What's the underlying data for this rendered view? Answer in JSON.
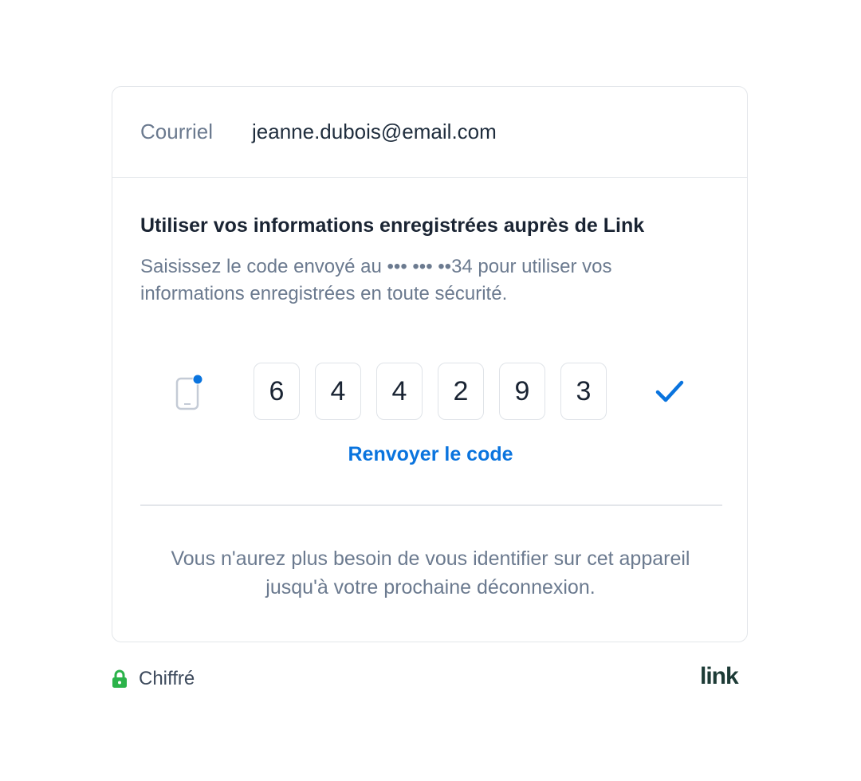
{
  "email": {
    "label": "Courriel",
    "value": "jeanne.dubois@email.com"
  },
  "verification": {
    "heading": "Utiliser vos informations enregistrées auprès de Link",
    "description": "Saisissez le code envoyé au ••• ••• ••34 pour utiliser vos informations enregistrées en toute sécurité.",
    "digits": [
      "6",
      "4",
      "4",
      "2",
      "9",
      "3"
    ],
    "resend_label": "Renvoyer le code",
    "footnote_line1": "Vous n'aurez plus besoin de vous identifier sur cet appareil",
    "footnote_line2": "jusqu'à votre prochaine déconnexion."
  },
  "footer": {
    "encrypted_label": "Chiffré",
    "logo_text": "link"
  },
  "icons": {
    "phone": "phone-notification-icon",
    "check": "check-icon",
    "lock": "lock-icon"
  },
  "colors": {
    "accent": "#0a74de",
    "lock_green": "#2bb34a",
    "text_dark": "#1a2433",
    "text_muted": "#6b7a8f",
    "logo": "#1d3b36"
  }
}
